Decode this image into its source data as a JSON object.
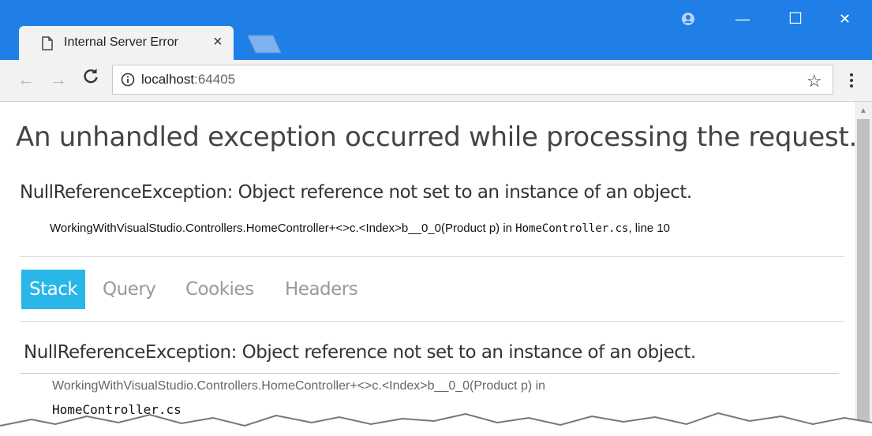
{
  "browser": {
    "tab_title": "Internal Server Error",
    "tab_close": "×",
    "url_host": "localhost",
    "url_port": ":64405",
    "window_controls": {
      "minimize": "—",
      "maximize": "☐",
      "close": "✕"
    },
    "nav": {
      "back": "←",
      "forward": "→",
      "bookmark": "☆"
    },
    "icons": [
      "page-icon",
      "profile-icon",
      "reload-icon",
      "info-icon",
      "star-icon",
      "menu-icon"
    ],
    "colors": {
      "titlebar": "#1f7fe6",
      "active_tab": "#29b6e8"
    }
  },
  "page": {
    "headline": "An unhandled exception occurred while processing the request.",
    "exception_title": "NullReferenceException: Object reference not set to an instance of an object.",
    "exception_location": {
      "method": "WorkingWithVisualStudio.Controllers.HomeController+<>c.<Index>b__0_0(Product p) in ",
      "file": "HomeController.cs",
      "suffix": ", line 10"
    },
    "tabs": [
      {
        "label": "Stack",
        "active": true
      },
      {
        "label": "Query",
        "active": false
      },
      {
        "label": "Cookies",
        "active": false
      },
      {
        "label": "Headers",
        "active": false
      }
    ],
    "stack": {
      "title": "NullReferenceException: Object reference not set to an instance of an object.",
      "method": "WorkingWithVisualStudio.Controllers.HomeController+<>c.<Index>b__0_0(Product p) in",
      "file": "HomeController.cs"
    }
  }
}
